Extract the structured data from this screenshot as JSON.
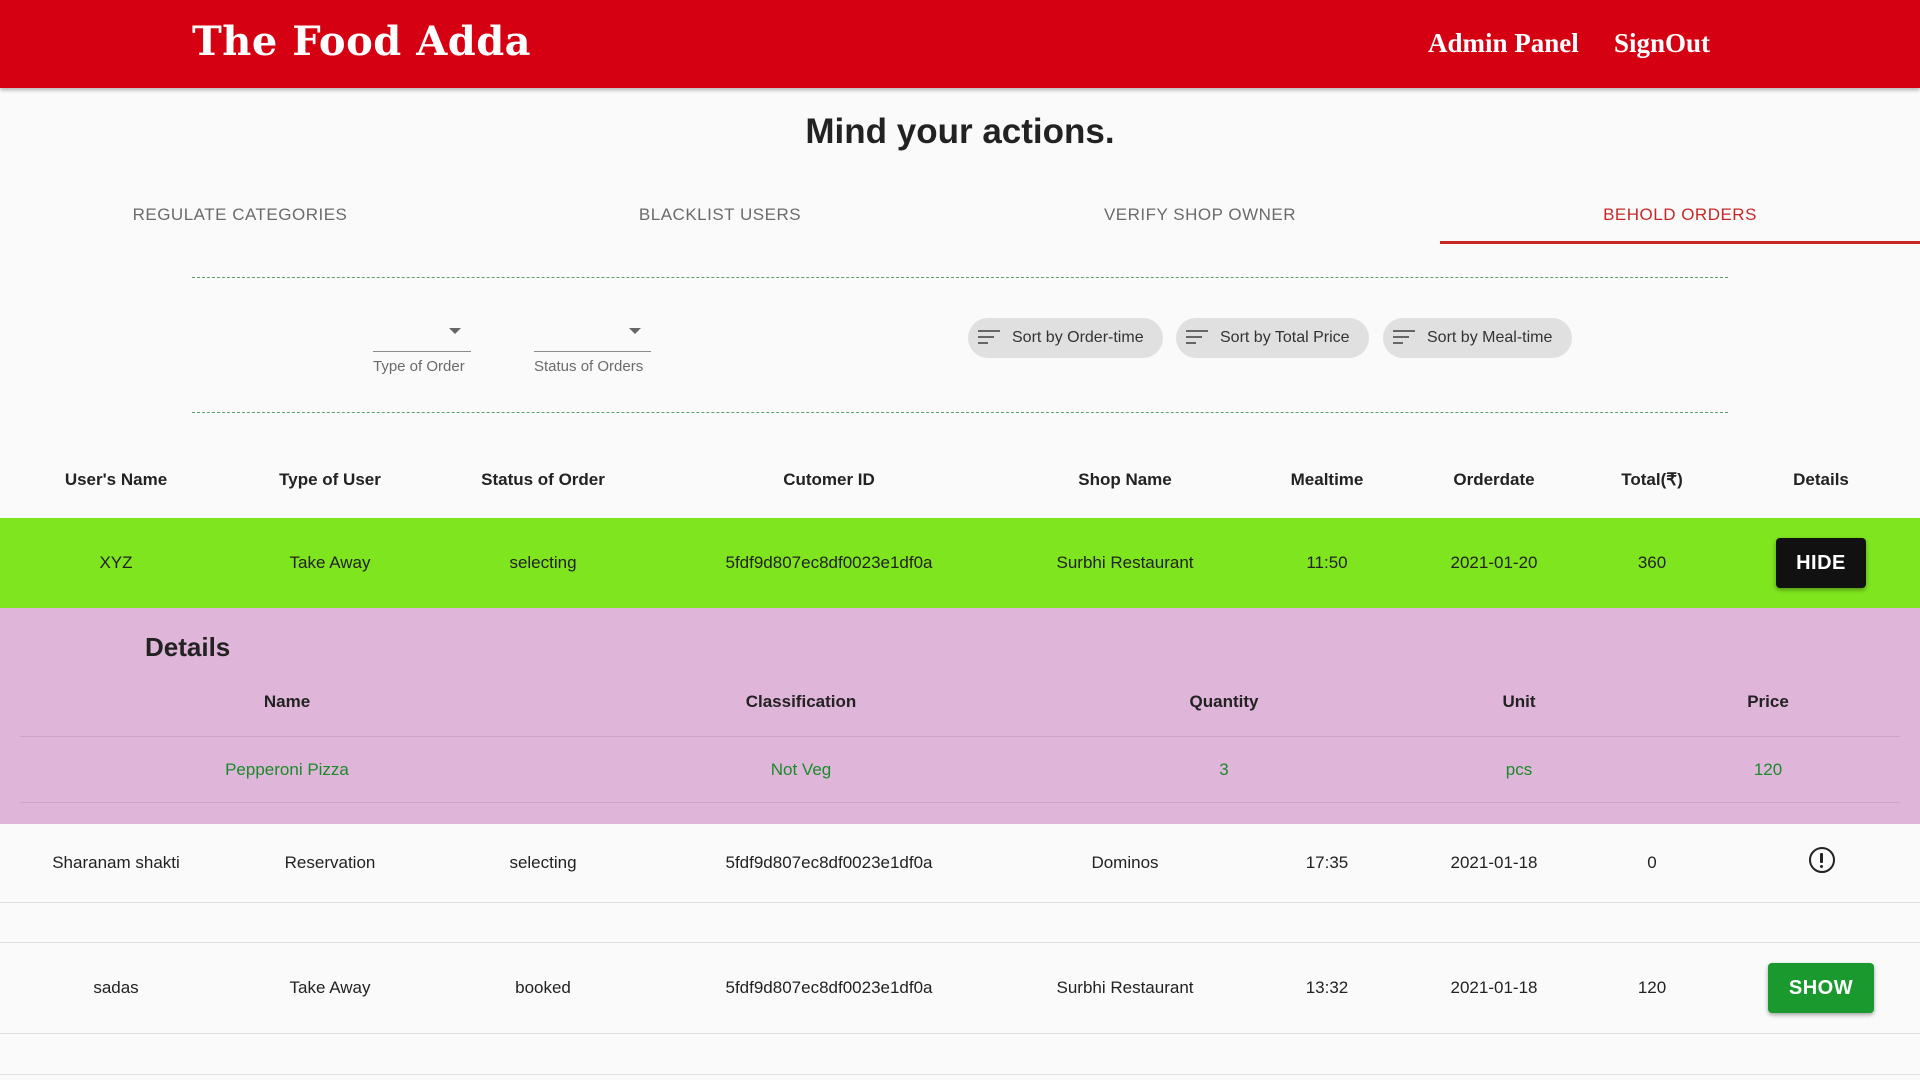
{
  "header": {
    "brand": "The Food Adda",
    "nav": {
      "admin_panel": "Admin Panel",
      "sign_out": "SignOut"
    },
    "color": "#d50012"
  },
  "page_title": "Mind your actions.",
  "tabs": [
    {
      "label": "REGULATE CATEGORIES",
      "active": false
    },
    {
      "label": "BLACKLIST USERS",
      "active": false
    },
    {
      "label": "VERIFY SHOP OWNER",
      "active": false
    },
    {
      "label": "BEHOLD ORDERS",
      "active": true
    }
  ],
  "filters": {
    "type_of_order": {
      "value": "",
      "helper": "Type of Order"
    },
    "status_of_orders": {
      "value": "",
      "helper": "Status of Orders"
    }
  },
  "sort_chips": [
    {
      "label": "Sort by Order-time",
      "icon": "sort-icon"
    },
    {
      "label": "Sort by Total Price",
      "icon": "sort-icon"
    },
    {
      "label": "Sort by Meal-time",
      "icon": "sort-icon"
    }
  ],
  "table": {
    "headers": [
      "User's Name",
      "Type of User",
      "Status of Order",
      "Cutomer ID",
      "Shop Name",
      "Mealtime",
      "Orderdate",
      "Total(₹)",
      "Details"
    ],
    "rows": [
      {
        "cells": [
          "XYZ",
          "Take Away",
          "selecting",
          "5fdf9d807ec8df0023e1df0a",
          "Surbhi Restaurant",
          "11:50",
          "2021-01-20",
          "360"
        ],
        "action": "HIDE",
        "highlight": "#7fe51e"
      },
      {
        "cells": [
          "Sharanam shakti",
          "Reservation",
          "selecting",
          "5fdf9d807ec8df0023e1df0a",
          "Dominos",
          "17:35",
          "2021-01-18",
          "0"
        ],
        "action_icon": "alert-circle-icon"
      },
      {
        "cells": [
          "sadas",
          "Take Away",
          "booked",
          "5fdf9d807ec8df0023e1df0a",
          "Surbhi Restaurant",
          "13:32",
          "2021-01-18",
          "120"
        ],
        "action": "SHOW"
      }
    ]
  },
  "details": {
    "title": "Details",
    "headers": [
      "Name",
      "Classification",
      "Quantity",
      "Unit",
      "Price"
    ],
    "items": [
      [
        "Pepperoni Pizza",
        "Not Veg",
        "3",
        "pcs",
        "120"
      ]
    ]
  }
}
